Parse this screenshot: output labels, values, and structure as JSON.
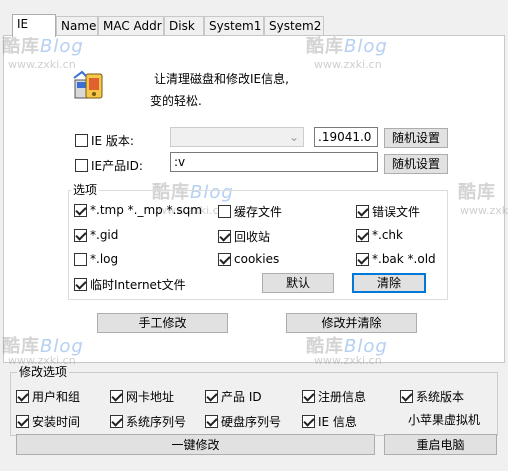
{
  "tabs": [
    {
      "label": "IE",
      "active": true
    },
    {
      "label": "Name",
      "active": false
    },
    {
      "label": "MAC Addr",
      "active": false
    },
    {
      "label": "Disk",
      "active": false
    },
    {
      "label": "System1",
      "active": false
    },
    {
      "label": "System2",
      "active": false
    }
  ],
  "watermark": {
    "text_cn": "酷库",
    "text_blog": "Blog",
    "url": "www.zxki.cn"
  },
  "intro": {
    "line1": "让清理磁盘和修改IE信息,",
    "line2": "变的轻松."
  },
  "ie_version": {
    "label": "IE 版本:",
    "checked": false,
    "combo_value": "",
    "value": ".19041.0",
    "random_button": "随机设置"
  },
  "ie_product_id": {
    "label": "IE产品ID:",
    "checked": false,
    "value": ":v",
    "random_button": "随机设置"
  },
  "options": {
    "title": "选项",
    "items": [
      {
        "label": "*.tmp  *._mp  *.sqm",
        "checked": true
      },
      {
        "label": "缓存文件",
        "checked": false
      },
      {
        "label": "错误文件",
        "checked": true
      },
      {
        "label": "*.gid",
        "checked": true
      },
      {
        "label": "回收站",
        "checked": true
      },
      {
        "label": "*.chk",
        "checked": true
      },
      {
        "label": "*.log",
        "checked": false
      },
      {
        "label": "cookies",
        "checked": true
      },
      {
        "label": "*.bak  *.old",
        "checked": true
      },
      {
        "label": "临时Internet文件",
        "checked": true
      }
    ],
    "default_button": "默认",
    "clear_button": "清除"
  },
  "actions": {
    "manual_modify": "手工修改",
    "modify_and_clear": "修改并清除"
  },
  "modify_options": {
    "title": "修改选项",
    "items": [
      {
        "label": "用户和组",
        "checked": true
      },
      {
        "label": "网卡地址",
        "checked": true
      },
      {
        "label": "产品 ID",
        "checked": true
      },
      {
        "label": "注册信息",
        "checked": true
      },
      {
        "label": "系统版本",
        "checked": true
      },
      {
        "label": "安装时间",
        "checked": true
      },
      {
        "label": "系统序列号",
        "checked": true
      },
      {
        "label": "硬盘序列号",
        "checked": true
      },
      {
        "label": "IE 信息",
        "checked": true
      }
    ],
    "vm_label": "小苹果虚拟机"
  },
  "bottom": {
    "one_click_modify": "一键修改",
    "restart": "重启电脑"
  },
  "colors": {
    "window_bg": "#f0f0f0",
    "panel_bg": "#ffffff",
    "button_bg": "#e1e1e1",
    "focus_border": "#0078d7"
  }
}
